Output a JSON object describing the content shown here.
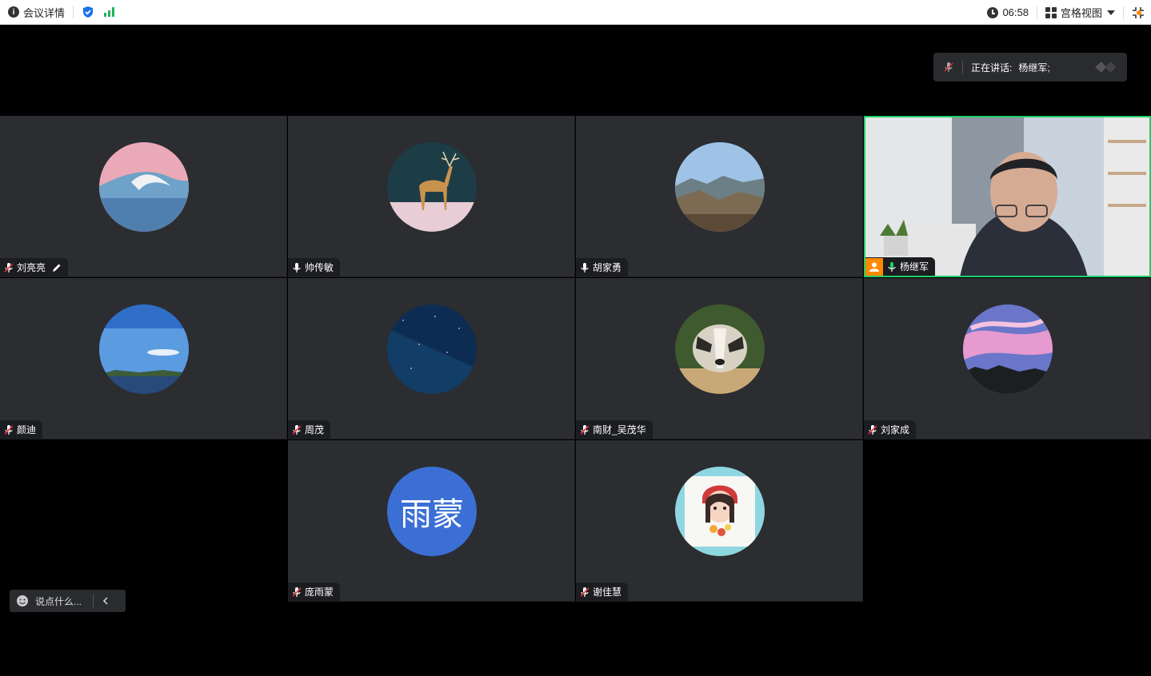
{
  "topbar": {
    "meeting_info_label": "会议详情",
    "time": "06:58",
    "view_mode": "宫格视图"
  },
  "speaking": {
    "label": "正在讲话:",
    "speaker": "杨继军;"
  },
  "participants": [
    {
      "name": "刘亮亮",
      "mic": "muted",
      "avatar": "wave-photo"
    },
    {
      "name": "帅传敏",
      "mic": "on",
      "avatar": "deer-photo"
    },
    {
      "name": "胡家勇",
      "mic": "on",
      "avatar": "mountain-photo"
    },
    {
      "name": "杨继军",
      "mic": "speaking",
      "avatar": "live-video"
    },
    {
      "name": "颜迪",
      "mic": "muted",
      "avatar": "lake-sky-photo"
    },
    {
      "name": "周茂",
      "mic": "muted",
      "avatar": "starry-sky-photo"
    },
    {
      "name": "南财_吴茂华",
      "mic": "muted",
      "avatar": "badger-photo"
    },
    {
      "name": "刘家成",
      "mic": "muted",
      "avatar": "sunset-clouds-photo"
    },
    {
      "name": "庞雨蒙",
      "mic": "muted",
      "avatar": "text",
      "avatar_text": "雨蒙"
    },
    {
      "name": "谢佳慧",
      "mic": "muted",
      "avatar": "cartoon-girl"
    }
  ],
  "chat": {
    "placeholder": "说点什么..."
  },
  "colors": {
    "tile_bg": "#2b2d31",
    "active_border": "#1fcf6a",
    "muted_red": "#e0343c",
    "host_orange": "#ff8a00",
    "text_avatar_blue": "#3b6fd6"
  }
}
